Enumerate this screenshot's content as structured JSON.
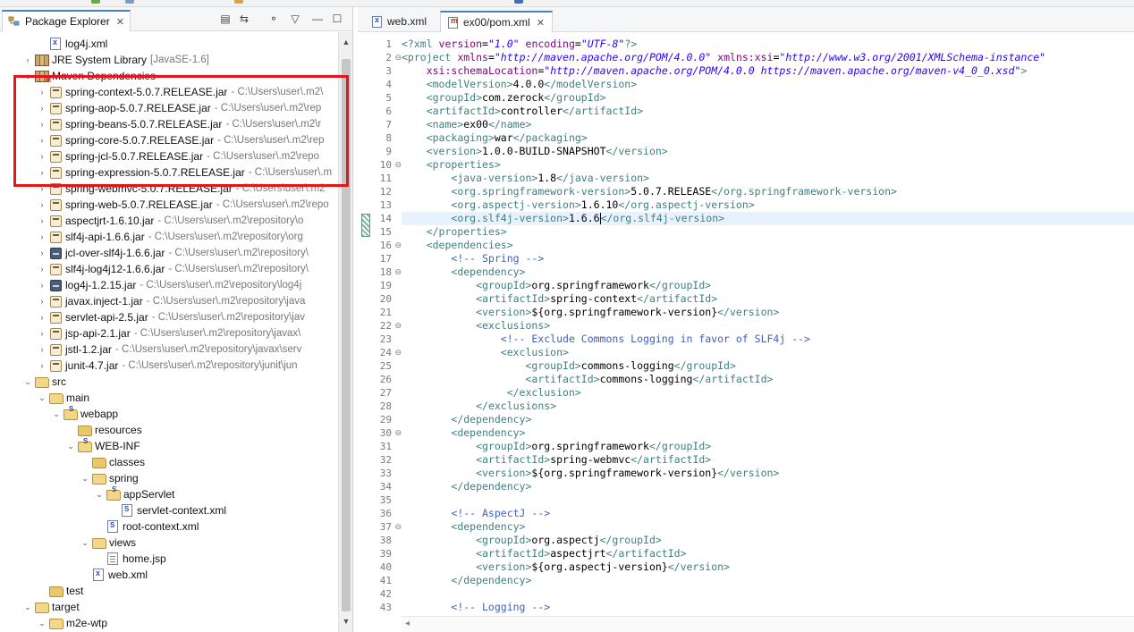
{
  "explorer": {
    "title": "Package Explorer",
    "close": "✕",
    "tree": [
      {
        "label": "log4j.xml",
        "path": "",
        "icon": "xml",
        "indent": 1,
        "twisty": ""
      },
      {
        "label": "JRE System Library",
        "path": "[JavaSE-1.6]",
        "icon": "lib",
        "indent": 0,
        "twisty": "›"
      },
      {
        "label": "Maven Dependencies",
        "path": "",
        "icon": "maven",
        "indent": 0,
        "twisty": "⌄"
      },
      {
        "label": "spring-context-5.0.7.RELEASE.jar",
        "path": "- C:\\Users\\user\\.m2\\",
        "icon": "jar",
        "indent": 1,
        "twisty": "›"
      },
      {
        "label": "spring-aop-5.0.7.RELEASE.jar",
        "path": "- C:\\Users\\user\\.m2\\rep",
        "icon": "jar",
        "indent": 1,
        "twisty": "›"
      },
      {
        "label": "spring-beans-5.0.7.RELEASE.jar",
        "path": "- C:\\Users\\user\\.m2\\r",
        "icon": "jar",
        "indent": 1,
        "twisty": "›"
      },
      {
        "label": "spring-core-5.0.7.RELEASE.jar",
        "path": "- C:\\Users\\user\\.m2\\rep",
        "icon": "jar",
        "indent": 1,
        "twisty": "›"
      },
      {
        "label": "spring-jcl-5.0.7.RELEASE.jar",
        "path": "- C:\\Users\\user\\.m2\\repo",
        "icon": "jar",
        "indent": 1,
        "twisty": "›"
      },
      {
        "label": "spring-expression-5.0.7.RELEASE.jar",
        "path": "- C:\\Users\\user\\.m",
        "icon": "jar",
        "indent": 1,
        "twisty": "›"
      },
      {
        "label": "spring-webmvc-5.0.7.RELEASE.jar",
        "path": "- C:\\Users\\user\\.m2",
        "icon": "jar",
        "indent": 1,
        "twisty": "›"
      },
      {
        "label": "spring-web-5.0.7.RELEASE.jar",
        "path": "- C:\\Users\\user\\.m2\\repo",
        "icon": "jar",
        "indent": 1,
        "twisty": "›"
      },
      {
        "label": "aspectjrt-1.6.10.jar",
        "path": "- C:\\Users\\user\\.m2\\repository\\o",
        "icon": "jar",
        "indent": 1,
        "twisty": "›"
      },
      {
        "label": "slf4j-api-1.6.6.jar",
        "path": "- C:\\Users\\user\\.m2\\repository\\org",
        "icon": "jar",
        "indent": 1,
        "twisty": "›"
      },
      {
        "label": "jcl-over-slf4j-1.6.6.jar",
        "path": "- C:\\Users\\user\\.m2\\repository\\",
        "icon": "jardark",
        "indent": 1,
        "twisty": "›"
      },
      {
        "label": "slf4j-log4j12-1.6.6.jar",
        "path": "- C:\\Users\\user\\.m2\\repository\\",
        "icon": "jar",
        "indent": 1,
        "twisty": "›"
      },
      {
        "label": "log4j-1.2.15.jar",
        "path": "- C:\\Users\\user\\.m2\\repository\\log4j",
        "icon": "jardark",
        "indent": 1,
        "twisty": "›"
      },
      {
        "label": "javax.inject-1.jar",
        "path": "- C:\\Users\\user\\.m2\\repository\\java",
        "icon": "jar",
        "indent": 1,
        "twisty": "›"
      },
      {
        "label": "servlet-api-2.5.jar",
        "path": "- C:\\Users\\user\\.m2\\repository\\jav",
        "icon": "jar",
        "indent": 1,
        "twisty": "›"
      },
      {
        "label": "jsp-api-2.1.jar",
        "path": "- C:\\Users\\user\\.m2\\repository\\javax\\",
        "icon": "jar",
        "indent": 1,
        "twisty": "›"
      },
      {
        "label": "jstl-1.2.jar",
        "path": "- C:\\Users\\user\\.m2\\repository\\javax\\serv",
        "icon": "jar",
        "indent": 1,
        "twisty": "›"
      },
      {
        "label": "junit-4.7.jar",
        "path": "- C:\\Users\\user\\.m2\\repository\\junit\\jun",
        "icon": "jar",
        "indent": 1,
        "twisty": "›"
      },
      {
        "label": "src",
        "path": "",
        "icon": "folder-open",
        "indent": 0,
        "twisty": "⌄"
      },
      {
        "label": "main",
        "path": "",
        "icon": "folder-open",
        "indent": 1,
        "twisty": "⌄"
      },
      {
        "label": "webapp",
        "path": "",
        "icon": "folder-open-src",
        "indent": 2,
        "twisty": "⌄"
      },
      {
        "label": "resources",
        "path": "",
        "icon": "folder",
        "indent": 3,
        "twisty": ""
      },
      {
        "label": "WEB-INF",
        "path": "",
        "icon": "folder-open-src",
        "indent": 3,
        "twisty": "⌄"
      },
      {
        "label": "classes",
        "path": "",
        "icon": "folder",
        "indent": 4,
        "twisty": ""
      },
      {
        "label": "spring",
        "path": "",
        "icon": "folder-open",
        "indent": 4,
        "twisty": "⌄"
      },
      {
        "label": "appServlet",
        "path": "",
        "icon": "folder-open-src",
        "indent": 5,
        "twisty": "⌄"
      },
      {
        "label": "servlet-context.xml",
        "path": "",
        "icon": "spring",
        "indent": 6,
        "twisty": ""
      },
      {
        "label": "root-context.xml",
        "path": "",
        "icon": "spring",
        "indent": 5,
        "twisty": ""
      },
      {
        "label": "views",
        "path": "",
        "icon": "folder-open",
        "indent": 4,
        "twisty": "⌄"
      },
      {
        "label": "home.jsp",
        "path": "",
        "icon": "jsp",
        "indent": 5,
        "twisty": ""
      },
      {
        "label": "web.xml",
        "path": "",
        "icon": "xml",
        "indent": 4,
        "twisty": ""
      },
      {
        "label": "test",
        "path": "",
        "icon": "folder",
        "indent": 1,
        "twisty": ""
      },
      {
        "label": "target",
        "path": "",
        "icon": "folder-open",
        "indent": 0,
        "twisty": "⌄"
      },
      {
        "label": "m2e-wtp",
        "path": "",
        "icon": "folder-open",
        "indent": 1,
        "twisty": "⌄"
      }
    ]
  },
  "editor": {
    "tabs": [
      {
        "label": "web.xml",
        "active": false,
        "close": ""
      },
      {
        "label": "ex00/pom.xml",
        "active": true,
        "close": "✕"
      }
    ],
    "current_line": 14,
    "lines": [
      {
        "n": "1",
        "fold": "",
        "s": [
          [
            "tag",
            "<?xml "
          ],
          [
            "attr",
            "version"
          ],
          [
            "txt",
            "="
          ],
          [
            "val",
            "\"1.0\""
          ],
          [
            "txt",
            " "
          ],
          [
            "attr",
            "encoding"
          ],
          [
            "txt",
            "="
          ],
          [
            "val",
            "\"UTF-8\""
          ],
          [
            "tag",
            "?>"
          ]
        ]
      },
      {
        "n": "2",
        "fold": "⊖",
        "s": [
          [
            "tag",
            "<project "
          ],
          [
            "attr",
            "xmlns"
          ],
          [
            "txt",
            "="
          ],
          [
            "val",
            "\"http://maven.apache.org/POM/4.0.0\""
          ],
          [
            "txt",
            " "
          ],
          [
            "attr",
            "xmlns:xsi"
          ],
          [
            "txt",
            "="
          ],
          [
            "val",
            "\"http://www.w3.org/2001/XMLSchema-instance\""
          ]
        ]
      },
      {
        "n": "3",
        "fold": "",
        "s": [
          [
            "txt",
            "    "
          ],
          [
            "attr",
            "xsi:schemaLocation"
          ],
          [
            "txt",
            "="
          ],
          [
            "val",
            "\"http://maven.apache.org/POM/4.0.0 https://maven.apache.org/maven-v4_0_0.xsd\""
          ],
          [
            "tag",
            ">"
          ]
        ]
      },
      {
        "n": "4",
        "fold": "",
        "s": [
          [
            "txt",
            "    "
          ],
          [
            "tag",
            "<modelVersion>"
          ],
          [
            "txt",
            "4.0.0"
          ],
          [
            "tag",
            "</modelVersion>"
          ]
        ]
      },
      {
        "n": "5",
        "fold": "",
        "s": [
          [
            "txt",
            "    "
          ],
          [
            "tag",
            "<groupId>"
          ],
          [
            "txt",
            "com.zerock"
          ],
          [
            "tag",
            "</groupId>"
          ]
        ]
      },
      {
        "n": "6",
        "fold": "",
        "s": [
          [
            "txt",
            "    "
          ],
          [
            "tag",
            "<artifactId>"
          ],
          [
            "txt",
            "controller"
          ],
          [
            "tag",
            "</artifactId>"
          ]
        ]
      },
      {
        "n": "7",
        "fold": "",
        "s": [
          [
            "txt",
            "    "
          ],
          [
            "tag",
            "<name>"
          ],
          [
            "txt",
            "ex00"
          ],
          [
            "tag",
            "</name>"
          ]
        ]
      },
      {
        "n": "8",
        "fold": "",
        "s": [
          [
            "txt",
            "    "
          ],
          [
            "tag",
            "<packaging>"
          ],
          [
            "txt",
            "war"
          ],
          [
            "tag",
            "</packaging>"
          ]
        ]
      },
      {
        "n": "9",
        "fold": "",
        "s": [
          [
            "txt",
            "    "
          ],
          [
            "tag",
            "<version>"
          ],
          [
            "txt",
            "1.0.0-BUILD-SNAPSHOT"
          ],
          [
            "tag",
            "</version>"
          ]
        ]
      },
      {
        "n": "10",
        "fold": "⊖",
        "s": [
          [
            "txt",
            "    "
          ],
          [
            "tag",
            "<properties>"
          ]
        ]
      },
      {
        "n": "11",
        "fold": "",
        "s": [
          [
            "txt",
            "        "
          ],
          [
            "tag",
            "<java-version>"
          ],
          [
            "txt",
            "1.8"
          ],
          [
            "tag",
            "</java-version>"
          ]
        ]
      },
      {
        "n": "12",
        "fold": "",
        "s": [
          [
            "txt",
            "        "
          ],
          [
            "tag",
            "<org.springframework-version>"
          ],
          [
            "txt",
            "5.0.7.RELEASE"
          ],
          [
            "tag",
            "</org.springframework-version>"
          ]
        ]
      },
      {
        "n": "13",
        "fold": "",
        "s": [
          [
            "txt",
            "        "
          ],
          [
            "tag",
            "<org.aspectj-version>"
          ],
          [
            "txt",
            "1.6.10"
          ],
          [
            "tag",
            "</org.aspectj-version>"
          ]
        ]
      },
      {
        "n": "14",
        "fold": "",
        "s": [
          [
            "txt",
            "        "
          ],
          [
            "tag",
            "<org.slf4j-version>"
          ],
          [
            "txt",
            "1.6.6"
          ],
          [
            "caret",
            ""
          ],
          [
            "tag",
            "</org.slf4j-version>"
          ]
        ]
      },
      {
        "n": "15",
        "fold": "",
        "s": [
          [
            "txt",
            "    "
          ],
          [
            "tag",
            "</properties>"
          ]
        ]
      },
      {
        "n": "16",
        "fold": "⊖",
        "s": [
          [
            "txt",
            "    "
          ],
          [
            "tag",
            "<dependencies>"
          ]
        ]
      },
      {
        "n": "17",
        "fold": "",
        "s": [
          [
            "txt",
            "        "
          ],
          [
            "com",
            "<!-- Spring -->"
          ]
        ]
      },
      {
        "n": "18",
        "fold": "⊖",
        "s": [
          [
            "txt",
            "        "
          ],
          [
            "tag",
            "<dependency>"
          ]
        ]
      },
      {
        "n": "19",
        "fold": "",
        "s": [
          [
            "txt",
            "            "
          ],
          [
            "tag",
            "<groupId>"
          ],
          [
            "txt",
            "org.springframework"
          ],
          [
            "tag",
            "</groupId>"
          ]
        ]
      },
      {
        "n": "20",
        "fold": "",
        "s": [
          [
            "txt",
            "            "
          ],
          [
            "tag",
            "<artifactId>"
          ],
          [
            "txt",
            "spring-context"
          ],
          [
            "tag",
            "</artifactId>"
          ]
        ]
      },
      {
        "n": "21",
        "fold": "",
        "s": [
          [
            "txt",
            "            "
          ],
          [
            "tag",
            "<version>"
          ],
          [
            "txt",
            "${org.springframework-version}"
          ],
          [
            "tag",
            "</version>"
          ]
        ]
      },
      {
        "n": "22",
        "fold": "⊖",
        "s": [
          [
            "txt",
            "            "
          ],
          [
            "tag",
            "<exclusions>"
          ]
        ]
      },
      {
        "n": "23",
        "fold": "",
        "s": [
          [
            "txt",
            "                "
          ],
          [
            "com",
            "<!-- Exclude Commons Logging in favor of SLF4j -->"
          ]
        ]
      },
      {
        "n": "24",
        "fold": "⊖",
        "s": [
          [
            "txt",
            "                "
          ],
          [
            "tag",
            "<exclusion>"
          ]
        ]
      },
      {
        "n": "25",
        "fold": "",
        "s": [
          [
            "txt",
            "                    "
          ],
          [
            "tag",
            "<groupId>"
          ],
          [
            "txt",
            "commons-logging"
          ],
          [
            "tag",
            "</groupId>"
          ]
        ]
      },
      {
        "n": "26",
        "fold": "",
        "s": [
          [
            "txt",
            "                    "
          ],
          [
            "tag",
            "<artifactId>"
          ],
          [
            "txt",
            "commons-logging"
          ],
          [
            "tag",
            "</artifactId>"
          ]
        ]
      },
      {
        "n": "27",
        "fold": "",
        "s": [
          [
            "txt",
            "                 "
          ],
          [
            "tag",
            "</exclusion>"
          ]
        ]
      },
      {
        "n": "28",
        "fold": "",
        "s": [
          [
            "txt",
            "            "
          ],
          [
            "tag",
            "</exclusions>"
          ]
        ]
      },
      {
        "n": "29",
        "fold": "",
        "s": [
          [
            "txt",
            "        "
          ],
          [
            "tag",
            "</dependency>"
          ]
        ]
      },
      {
        "n": "30",
        "fold": "⊖",
        "s": [
          [
            "txt",
            "        "
          ],
          [
            "tag",
            "<dependency>"
          ]
        ]
      },
      {
        "n": "31",
        "fold": "",
        "s": [
          [
            "txt",
            "            "
          ],
          [
            "tag",
            "<groupId>"
          ],
          [
            "txt",
            "org.springframework"
          ],
          [
            "tag",
            "</groupId>"
          ]
        ]
      },
      {
        "n": "32",
        "fold": "",
        "s": [
          [
            "txt",
            "            "
          ],
          [
            "tag",
            "<artifactId>"
          ],
          [
            "txt",
            "spring-webmvc"
          ],
          [
            "tag",
            "</artifactId>"
          ]
        ]
      },
      {
        "n": "33",
        "fold": "",
        "s": [
          [
            "txt",
            "            "
          ],
          [
            "tag",
            "<version>"
          ],
          [
            "txt",
            "${org.springframework-version}"
          ],
          [
            "tag",
            "</version>"
          ]
        ]
      },
      {
        "n": "34",
        "fold": "",
        "s": [
          [
            "txt",
            "        "
          ],
          [
            "tag",
            "</dependency>"
          ]
        ]
      },
      {
        "n": "35",
        "fold": "",
        "s": []
      },
      {
        "n": "36",
        "fold": "",
        "s": [
          [
            "txt",
            "        "
          ],
          [
            "com",
            "<!-- AspectJ -->"
          ]
        ]
      },
      {
        "n": "37",
        "fold": "⊖",
        "s": [
          [
            "txt",
            "        "
          ],
          [
            "tag",
            "<dependency>"
          ]
        ]
      },
      {
        "n": "38",
        "fold": "",
        "s": [
          [
            "txt",
            "            "
          ],
          [
            "tag",
            "<groupId>"
          ],
          [
            "txt",
            "org.aspectj"
          ],
          [
            "tag",
            "</groupId>"
          ]
        ]
      },
      {
        "n": "39",
        "fold": "",
        "s": [
          [
            "txt",
            "            "
          ],
          [
            "tag",
            "<artifactId>"
          ],
          [
            "txt",
            "aspectjrt"
          ],
          [
            "tag",
            "</artifactId>"
          ]
        ]
      },
      {
        "n": "40",
        "fold": "",
        "s": [
          [
            "txt",
            "            "
          ],
          [
            "tag",
            "<version>"
          ],
          [
            "txt",
            "${org.aspectj-version}"
          ],
          [
            "tag",
            "</version>"
          ]
        ]
      },
      {
        "n": "41",
        "fold": "",
        "s": [
          [
            "txt",
            "        "
          ],
          [
            "tag",
            "</dependency>"
          ]
        ]
      },
      {
        "n": "42",
        "fold": "",
        "s": []
      },
      {
        "n": "43",
        "fold": "",
        "s": [
          [
            "txt",
            "        "
          ],
          [
            "com",
            "<!-- Logging -->"
          ]
        ]
      }
    ]
  },
  "colors": {
    "highlight_box": "#e6141b",
    "active_tab_accent": "#4d7fc5",
    "current_line": "#e8f2fe"
  }
}
